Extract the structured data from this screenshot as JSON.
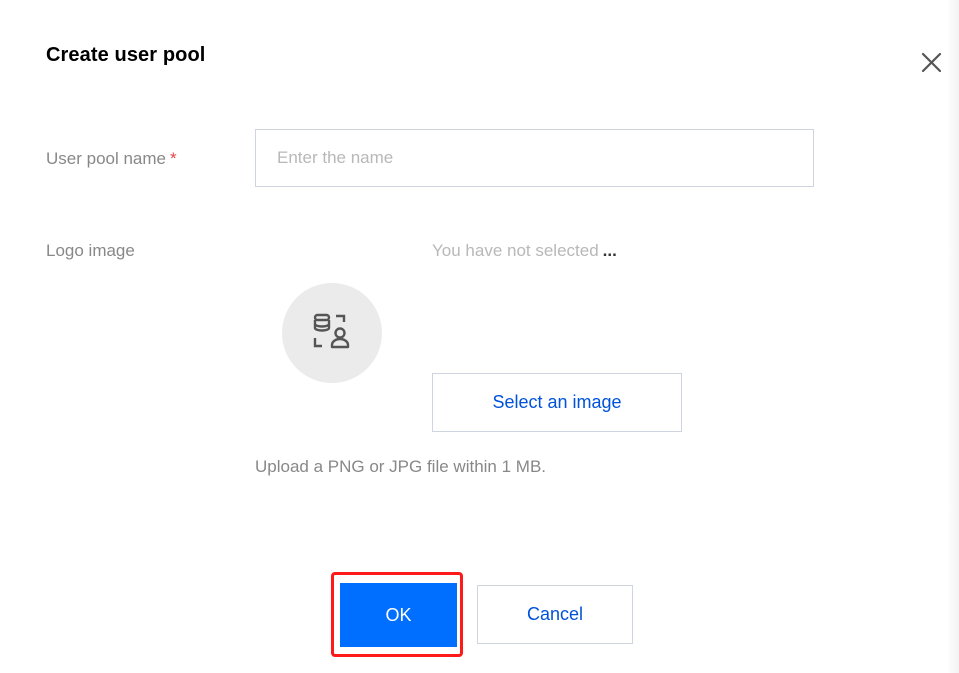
{
  "dialog": {
    "title": "Create user pool",
    "close_icon": "close-icon"
  },
  "form": {
    "name_label": "User pool name",
    "required_mark": "*",
    "name_input": {
      "value": "",
      "placeholder": "Enter the name"
    },
    "logo_label": "Logo image",
    "logo_status": "You have not selected",
    "logo_status_more": "...",
    "avatar_icon": "user-database-icon",
    "select_image_label": "Select an image",
    "upload_hint": "Upload a PNG or JPG file within 1 MB."
  },
  "footer": {
    "ok_label": "OK",
    "cancel_label": "Cancel",
    "highlight_color": "#ff1a1a",
    "primary_color": "#006eff"
  }
}
